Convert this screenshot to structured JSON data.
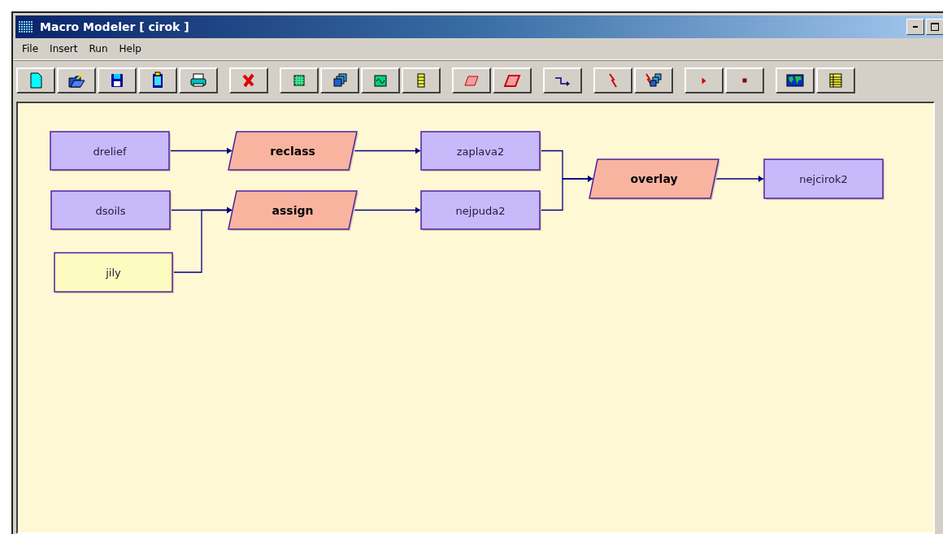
{
  "window": {
    "title": "Macro Modeler  [ cirok ]"
  },
  "menu": [
    {
      "label": "File"
    },
    {
      "label": "Insert"
    },
    {
      "label": "Run"
    },
    {
      "label": "Help"
    }
  ],
  "diagram": {
    "nodes": [
      {
        "label": "drelief",
        "kind": "data"
      },
      {
        "label": "dsoils",
        "kind": "data"
      },
      {
        "label": "jily",
        "kind": "file"
      },
      {
        "label": "reclass",
        "kind": "module"
      },
      {
        "label": "assign",
        "kind": "module"
      },
      {
        "label": "zaplava2",
        "kind": "data"
      },
      {
        "label": "nejpuda2",
        "kind": "data"
      },
      {
        "label": "overlay",
        "kind": "module"
      },
      {
        "label": "nejcirok2",
        "kind": "data"
      }
    ]
  }
}
